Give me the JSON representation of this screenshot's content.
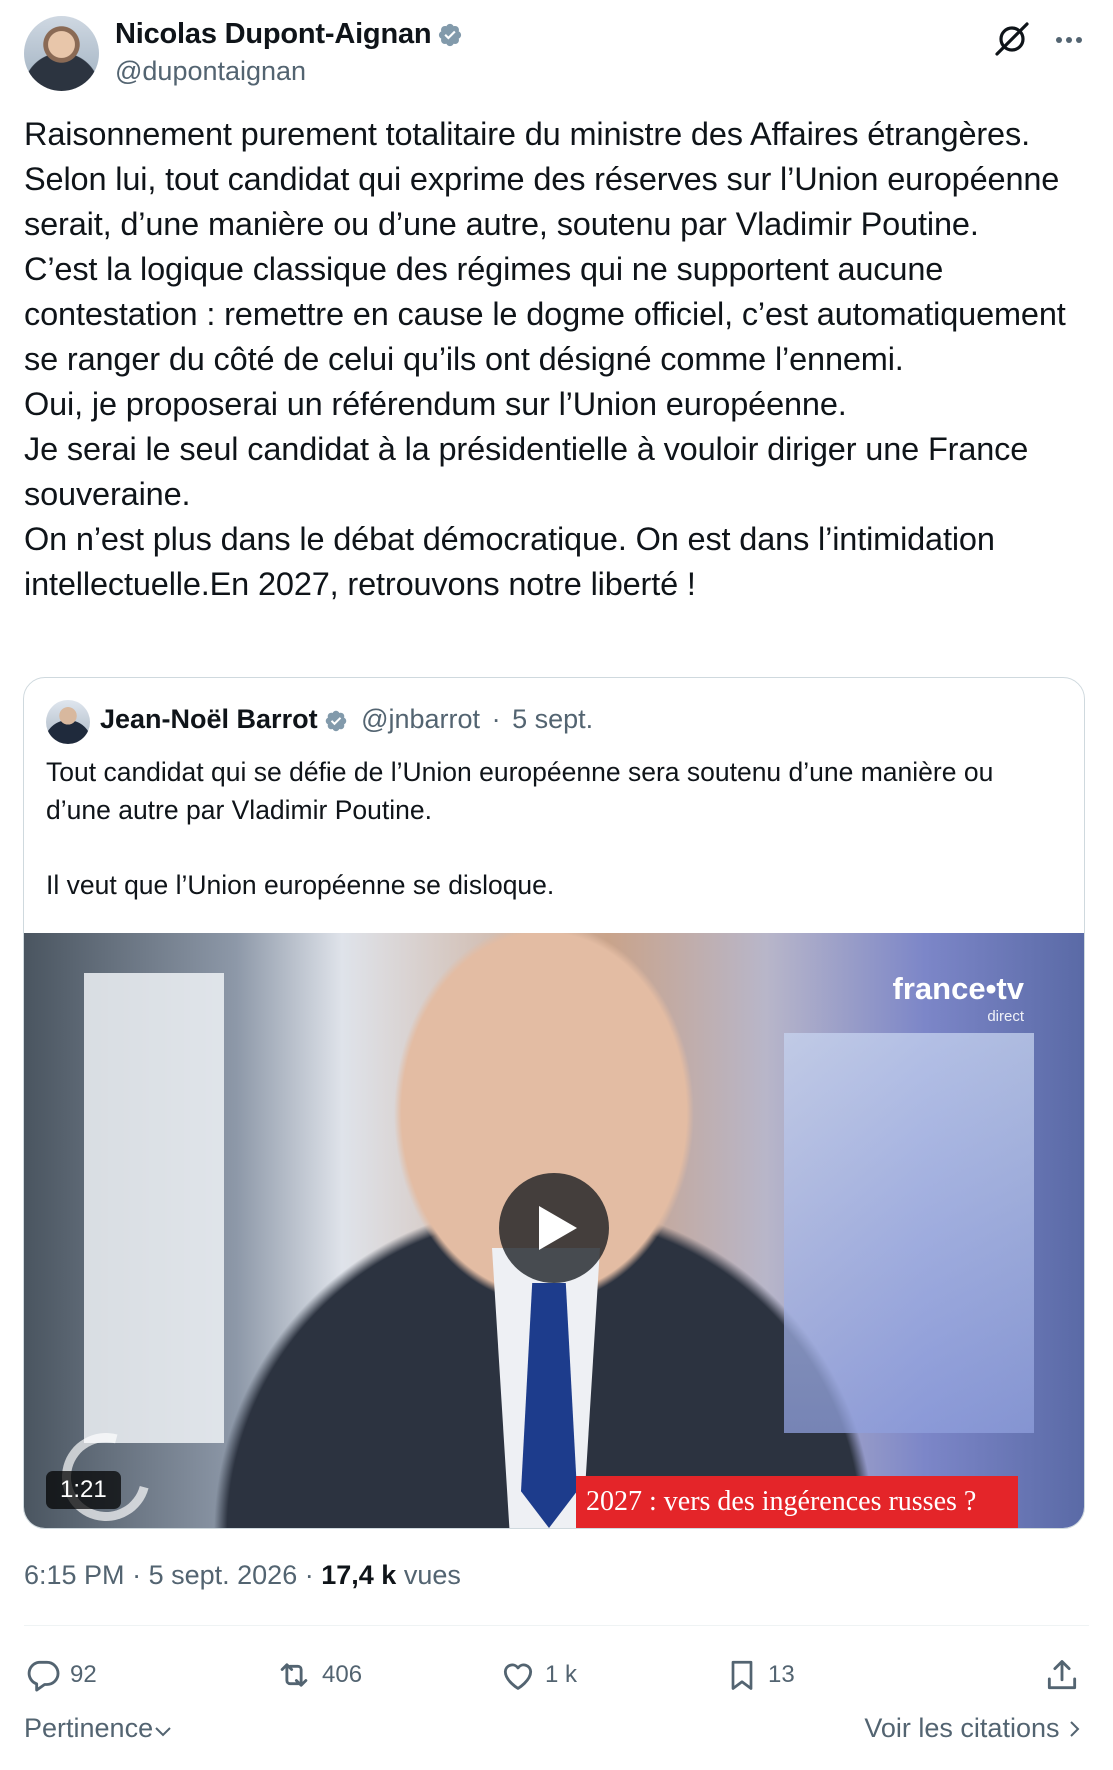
{
  "author": {
    "name": "Nicolas Dupont-Aignan",
    "handle": "@dupontaignan"
  },
  "tweet": {
    "text": "Raisonnement purement totalitaire du ministre des Affaires étrangères.\nSelon lui, tout candidat qui exprime des réserves sur l’Union européenne serait, d’une manière ou d’une autre, soutenu par Vladimir Poutine.\nC’est la logique classique des régimes qui ne supportent aucune contestation : remettre en cause le dogme officiel, c’est automatiquement se ranger du côté de celui qu’ils ont désigné comme l’ennemi.\nOui, je proposerai un référendum sur l’Union européenne.\nJe serai le seul candidat à la présidentielle à vouloir diriger une France souveraine.\nOn n’est plus dans le débat démocratique. On est dans l’intimidation intellectuelle.En 2027, retrouvons notre liberté !",
    "time": "6:15 PM",
    "date": "5 sept. 2026",
    "views": "17,4 k",
    "views_label": "vues"
  },
  "quoted": {
    "name": "Jean-Noël Barrot",
    "handle": "@jnbarrot",
    "date": "5 sept.",
    "text": "Tout candidat qui se défie de l’Union européenne sera soutenu d’une manière ou d’une autre par Vladimir Poutine.\n\nIl veut que l’Union européenne se disloque.",
    "video": {
      "duration": "1:21",
      "banner": "2027 : vers des ingérences russes ?",
      "channel_logo": "france•tv",
      "channel_sub": "direct"
    }
  },
  "actions": {
    "replies": "92",
    "reposts": "406",
    "likes": "1 k",
    "bookmarks": "13"
  },
  "footer": {
    "sort_label": "Pertinence",
    "quotes_link": "Voir les citations"
  },
  "colors": {
    "verified": "#829aab",
    "secondary_text": "#536471",
    "banner": "#e42529"
  }
}
